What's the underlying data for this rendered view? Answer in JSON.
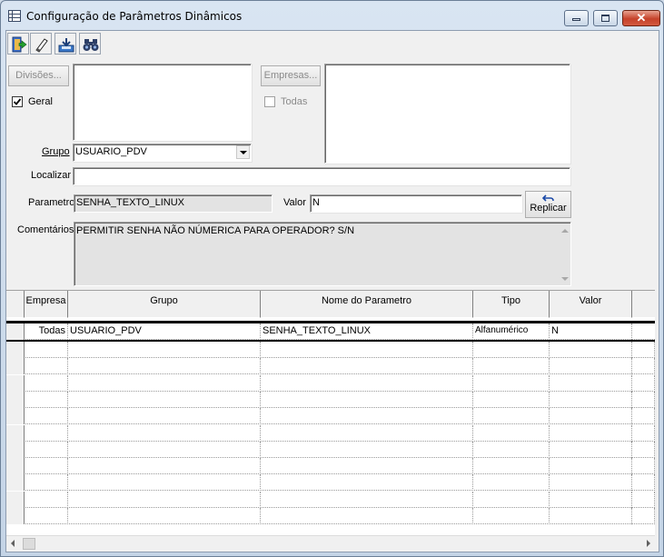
{
  "window": {
    "title": "Configuração de Parâmetros Dinâmicos",
    "min_label": "▭",
    "max_label": "□",
    "close_label": "✕"
  },
  "toolbar": {
    "items": [
      {
        "name": "exit-icon",
        "tooltip": ""
      },
      {
        "name": "eraser-icon",
        "tooltip": ""
      },
      {
        "name": "save-icon",
        "tooltip": ""
      },
      {
        "name": "binoculars-icon",
        "tooltip": ""
      }
    ]
  },
  "form": {
    "divisoes_button": "Divisões...",
    "empresas_button": "Empresas...",
    "geral_label": "Geral",
    "geral_checked": true,
    "todas_label": "Todas",
    "todas_checked": false,
    "grupo_label": "Grupo",
    "grupo_value": "USUARIO_PDV",
    "localizar_label": "Localizar",
    "localizar_value": "",
    "parametro_label": "Parametro",
    "parametro_value": "SENHA_TEXTO_LINUX",
    "valor_label": "Valor",
    "valor_value": "N",
    "replicar_button": "Replicar",
    "comentarios_label": "Comentários",
    "comentarios_value": "PERMITIR SENHA NÃO NÚMERICA PARA OPERADOR? S/N"
  },
  "grid": {
    "columns": [
      "Empresa",
      "Grupo",
      "Nome do Parametro",
      "Tipo",
      "Valor"
    ],
    "rows": [
      [
        "Todas",
        "USUARIO_PDV",
        "SENHA_TEXTO_LINUX",
        "Alfanumérico",
        "N"
      ]
    ],
    "empty_rows": 11
  },
  "colors": {
    "accent_close": "#c6422a",
    "window_frame": "#c4d4e6",
    "client_bg": "#f0f0f0"
  }
}
